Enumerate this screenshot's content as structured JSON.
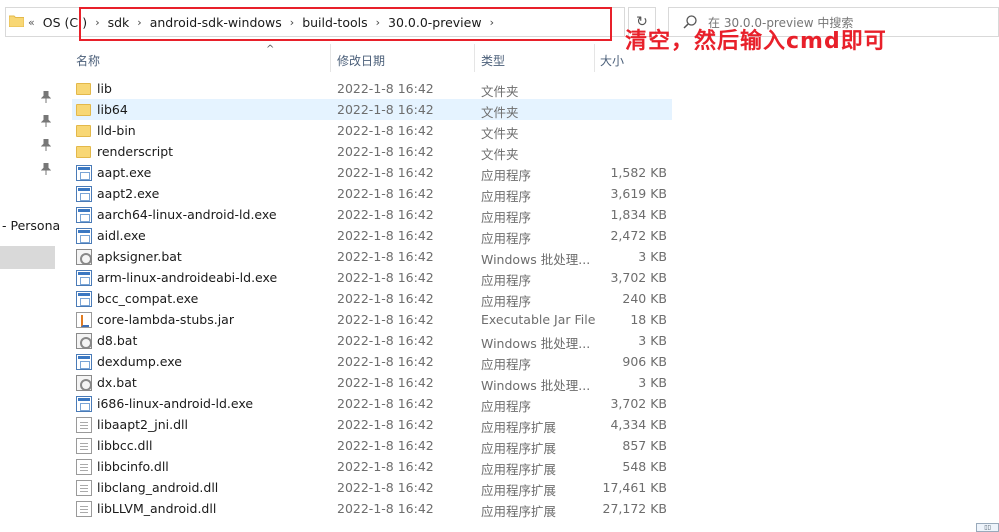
{
  "address_bar": {
    "overflow_chevron": "«",
    "crumbs": [
      "OS (C:)",
      "sdk",
      "android-sdk-windows",
      "build-tools",
      "30.0.0-preview"
    ],
    "search_placeholder": "在 30.0.0-preview 中搜索",
    "refresh_icon": "refresh-icon"
  },
  "annotation": {
    "text": "清空，然后输入cmd即可",
    "color": "#e8202a"
  },
  "nav_pane": {
    "label": "- Persona"
  },
  "columns": {
    "name": "名称",
    "date": "修改日期",
    "type": "类型",
    "size": "大小"
  },
  "files": [
    {
      "name": "lib",
      "date": "2022-1-8 16:42",
      "type": "文件夹",
      "size": "",
      "icon": "folder-icon"
    },
    {
      "name": "lib64",
      "date": "2022-1-8 16:42",
      "type": "文件夹",
      "size": "",
      "icon": "folder-icon"
    },
    {
      "name": "lld-bin",
      "date": "2022-1-8 16:42",
      "type": "文件夹",
      "size": "",
      "icon": "folder-icon"
    },
    {
      "name": "renderscript",
      "date": "2022-1-8 16:42",
      "type": "文件夹",
      "size": "",
      "icon": "folder-icon"
    },
    {
      "name": "aapt.exe",
      "date": "2022-1-8 16:42",
      "type": "应用程序",
      "size": "1,582 KB",
      "icon": "exe-icon"
    },
    {
      "name": "aapt2.exe",
      "date": "2022-1-8 16:42",
      "type": "应用程序",
      "size": "3,619 KB",
      "icon": "exe-icon"
    },
    {
      "name": "aarch64-linux-android-ld.exe",
      "date": "2022-1-8 16:42",
      "type": "应用程序",
      "size": "1,834 KB",
      "icon": "exe-icon"
    },
    {
      "name": "aidl.exe",
      "date": "2022-1-8 16:42",
      "type": "应用程序",
      "size": "2,472 KB",
      "icon": "exe-icon"
    },
    {
      "name": "apksigner.bat",
      "date": "2022-1-8 16:42",
      "type": "Windows 批处理...",
      "size": "3 KB",
      "icon": "bat-icon"
    },
    {
      "name": "arm-linux-androideabi-ld.exe",
      "date": "2022-1-8 16:42",
      "type": "应用程序",
      "size": "3,702 KB",
      "icon": "exe-icon"
    },
    {
      "name": "bcc_compat.exe",
      "date": "2022-1-8 16:42",
      "type": "应用程序",
      "size": "240 KB",
      "icon": "exe-icon"
    },
    {
      "name": "core-lambda-stubs.jar",
      "date": "2022-1-8 16:42",
      "type": "Executable Jar File",
      "size": "18 KB",
      "icon": "jar-icon"
    },
    {
      "name": "d8.bat",
      "date": "2022-1-8 16:42",
      "type": "Windows 批处理...",
      "size": "3 KB",
      "icon": "bat-icon"
    },
    {
      "name": "dexdump.exe",
      "date": "2022-1-8 16:42",
      "type": "应用程序",
      "size": "906 KB",
      "icon": "exe-icon"
    },
    {
      "name": "dx.bat",
      "date": "2022-1-8 16:42",
      "type": "Windows 批处理...",
      "size": "3 KB",
      "icon": "bat-icon"
    },
    {
      "name": "i686-linux-android-ld.exe",
      "date": "2022-1-8 16:42",
      "type": "应用程序",
      "size": "3,702 KB",
      "icon": "exe-icon"
    },
    {
      "name": "libaapt2_jni.dll",
      "date": "2022-1-8 16:42",
      "type": "应用程序扩展",
      "size": "4,334 KB",
      "icon": "dll-icon"
    },
    {
      "name": "libbcc.dll",
      "date": "2022-1-8 16:42",
      "type": "应用程序扩展",
      "size": "857 KB",
      "icon": "dll-icon"
    },
    {
      "name": "libbcinfo.dll",
      "date": "2022-1-8 16:42",
      "type": "应用程序扩展",
      "size": "548 KB",
      "icon": "dll-icon"
    },
    {
      "name": "libclang_android.dll",
      "date": "2022-1-8 16:42",
      "type": "应用程序扩展",
      "size": "17,461 KB",
      "icon": "dll-icon"
    },
    {
      "name": "libLLVM_android.dll",
      "date": "2022-1-8 16:42",
      "type": "应用程序扩展",
      "size": "27,172 KB",
      "icon": "dll-icon"
    }
  ],
  "selected_row_name": "lib64"
}
